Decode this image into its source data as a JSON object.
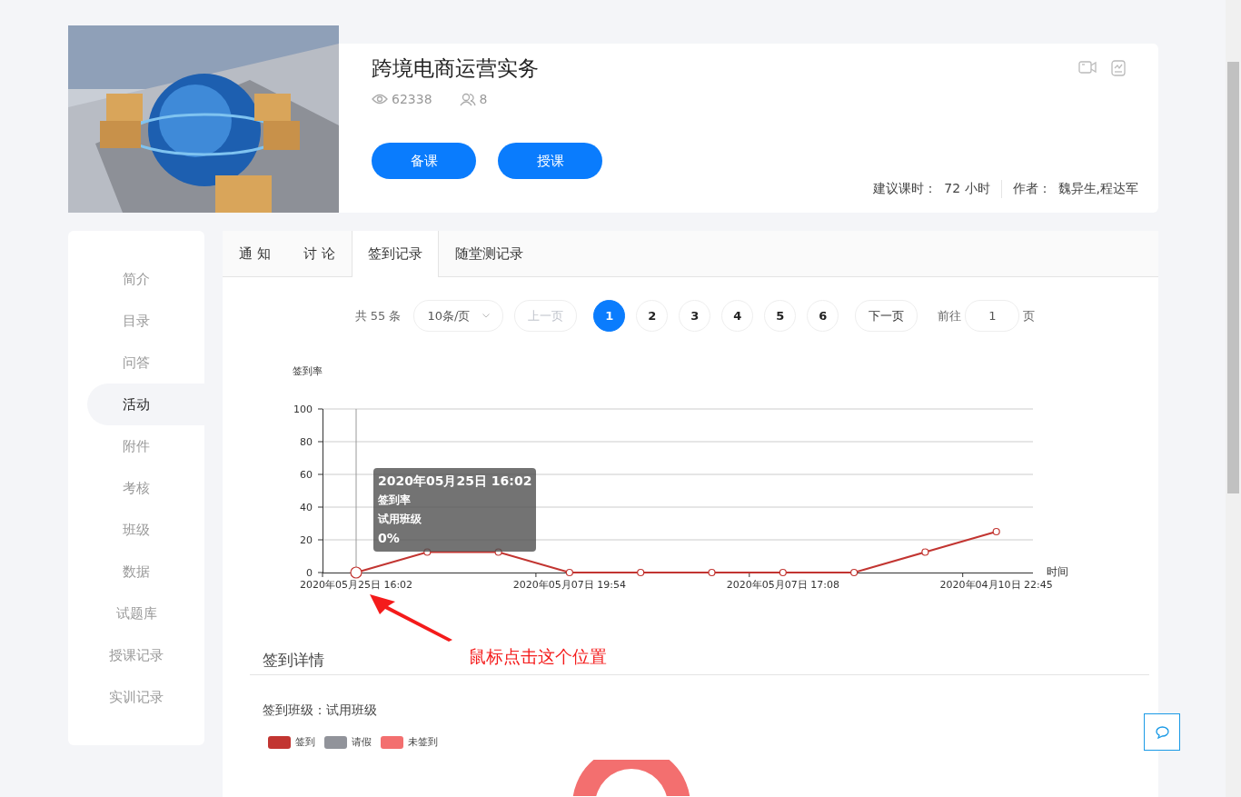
{
  "course": {
    "title": "跨境电商运营实务",
    "views": "62338",
    "members": "8",
    "buttons": [
      "备课",
      "授课"
    ],
    "hours_label": "建议课时：",
    "hours": "72 小时",
    "author_label": "作者：",
    "author": "魏异生,程达军"
  },
  "sidebar": {
    "items": [
      {
        "label": "简介",
        "selected": false
      },
      {
        "label": "目录",
        "selected": false
      },
      {
        "label": "问答",
        "selected": false
      },
      {
        "label": "活动",
        "selected": true
      },
      {
        "label": "附件",
        "selected": false
      },
      {
        "label": "考核",
        "selected": false
      },
      {
        "label": "班级",
        "selected": false
      },
      {
        "label": "数据",
        "selected": false
      },
      {
        "label": "试题库",
        "selected": false
      },
      {
        "label": "授课记录",
        "selected": false
      },
      {
        "label": "实训记录",
        "selected": false
      }
    ]
  },
  "tabs": [
    {
      "label": "通 知",
      "selected": false
    },
    {
      "label": "讨 论",
      "selected": false
    },
    {
      "label": "签到记录",
      "selected": true
    },
    {
      "label": "随堂测记录",
      "selected": false
    }
  ],
  "pagination": {
    "total": "共 55 条",
    "page_size": "10条/页",
    "prev": "上一页",
    "prev_disabled": true,
    "pages": [
      {
        "label": "1",
        "selected": true
      },
      {
        "label": "2",
        "selected": false
      },
      {
        "label": "3",
        "selected": false
      },
      {
        "label": "4",
        "selected": false
      },
      {
        "label": "5",
        "selected": false
      },
      {
        "label": "6",
        "selected": false
      }
    ],
    "next": "下一页",
    "goto": "前往",
    "goto_value": "1",
    "page_unit": "页"
  },
  "chart": {
    "chart_data": {
      "type": "line",
      "ylabel": "签到率",
      "xlabel": "时间",
      "categories": [
        "2020年05月25日 16:02",
        null,
        null,
        "2020年05月07日 19:54",
        null,
        null,
        "2020年05月07日 17:08",
        null,
        null,
        "2020年04月10日 22:45"
      ],
      "ylim": [
        0,
        100
      ],
      "grid": true,
      "yticks": [
        0,
        20,
        40,
        60,
        80,
        100
      ],
      "series": [
        {
          "name": "试用班级",
          "color": "#c23531",
          "marker": "circle",
          "values": [
            0,
            12.5,
            12.5,
            0,
            0,
            0,
            0,
            0,
            12.5,
            25
          ]
        }
      ]
    },
    "tooltip": {
      "title": "2020年05月25日 16:02",
      "metric": "签到率",
      "value": "0%"
    }
  },
  "annotation": "鼠标点击这个位置",
  "details": {
    "heading": "签到详情",
    "class_label": "签到班级：",
    "class_name": "试用班级",
    "legend": [
      {
        "label": "签到",
        "color": "#c23531"
      },
      {
        "label": "请假",
        "color": "#91939a"
      },
      {
        "label": "未签到",
        "color": "#f36f6f"
      }
    ]
  }
}
